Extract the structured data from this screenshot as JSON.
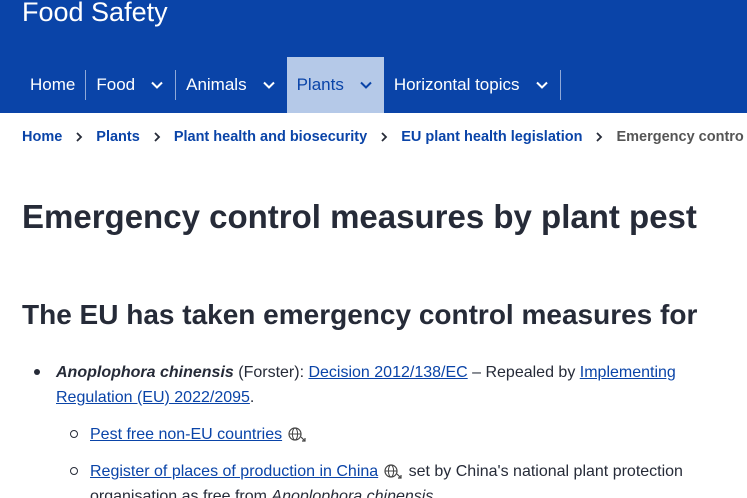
{
  "header": {
    "site_title": "Food Safety",
    "menu": [
      {
        "label": "Home",
        "has_dropdown": false,
        "active": false
      },
      {
        "label": "Food",
        "has_dropdown": true,
        "active": false
      },
      {
        "label": "Animals",
        "has_dropdown": true,
        "active": false
      },
      {
        "label": "Plants",
        "has_dropdown": true,
        "active": true
      },
      {
        "label": "Horizontal topics",
        "has_dropdown": true,
        "active": false
      }
    ],
    "colors": {
      "bar": "#0a44a8",
      "active_tab": "#b5c9e8"
    }
  },
  "breadcrumb": {
    "items": [
      "Home",
      "Plants",
      "Plant health and biosecurity",
      "EU plant health legislation"
    ],
    "current": "Emergency contro"
  },
  "page_title": "Emergency control measures by plant pest",
  "section_title": "The EU has taken emergency control measures for",
  "list": {
    "item1": {
      "species": "Anoplophora chinensis",
      "author": " (Forster): ",
      "decision_link": "Decision 2012/138/EC",
      "repealed_text": " – Repealed by ",
      "regulation_link": "Implementing Regulation (EU) 2022/2095",
      "end": "."
    },
    "sub_items": {
      "pest_free_link": "Pest free non-EU countries",
      "register_link": "Register of places of production in China",
      "register_text": " set by China's national plant protection organisation as free from ",
      "register_species": "Anoplophora chinensis"
    },
    "icons": {
      "external": "globe-external-icon",
      "separator": "chevron-right-icon"
    }
  }
}
